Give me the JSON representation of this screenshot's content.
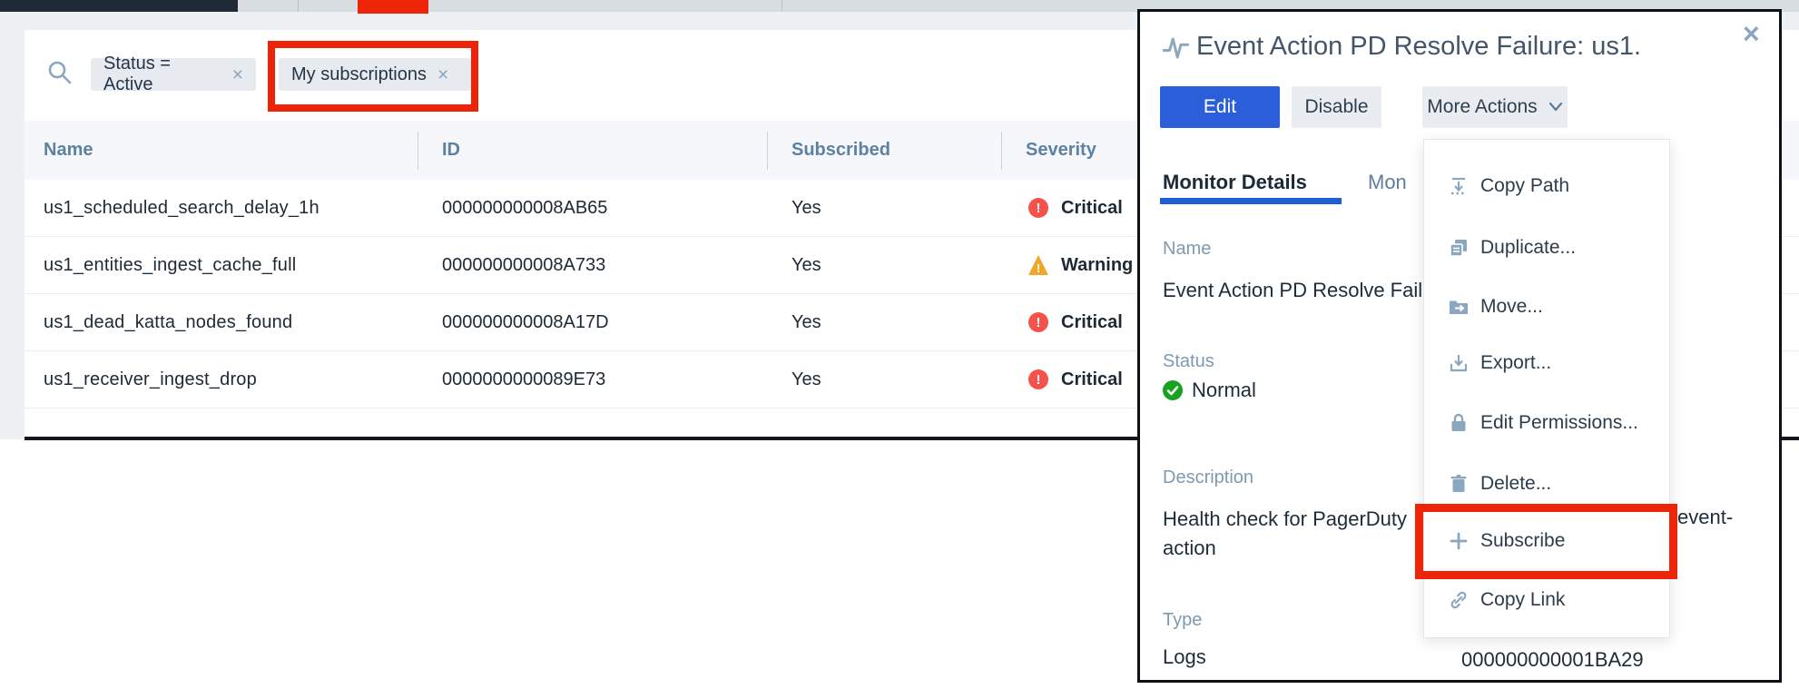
{
  "colors": {
    "annotation_red": "#ee2408",
    "primary_blue": "#2b5fd9",
    "tab_underline_blue": "#1f5ed6",
    "critical_red": "#f4524b",
    "warning_amber": "#eda82a",
    "normal_green": "#17a21f",
    "steel_label": "#7e9ab2",
    "header_text": "#5d81a1"
  },
  "filter_bar": {
    "search_icon": "search-icon",
    "chips": [
      {
        "label": "Status = Active",
        "close": "×"
      },
      {
        "label": "My subscriptions",
        "close": "×"
      }
    ]
  },
  "table": {
    "columns": [
      "Name",
      "ID",
      "Subscribed",
      "Severity"
    ],
    "rows": [
      {
        "name": "us1_scheduled_search_delay_1h",
        "id": "000000000008AB65",
        "subscribed": "Yes",
        "severity": "Critical",
        "severity_level": "critical"
      },
      {
        "name": "us1_entities_ingest_cache_full",
        "id": "000000000008A733",
        "subscribed": "Yes",
        "severity": "Warning",
        "severity_level": "warning"
      },
      {
        "name": "us1_dead_katta_nodes_found",
        "id": "000000000008A17D",
        "subscribed": "Yes",
        "severity": "Critical",
        "severity_level": "critical"
      },
      {
        "name": "us1_receiver_ingest_drop",
        "id": "0000000000089E73",
        "subscribed": "Yes",
        "severity": "Critical",
        "severity_level": "critical"
      }
    ]
  },
  "detail_panel": {
    "title": "Event Action PD Resolve Failure: us1.",
    "title_icon": "pulse-icon",
    "close": "×",
    "buttons": {
      "edit": "Edit",
      "disable": "Disable",
      "more_actions": "More Actions"
    },
    "tabs": {
      "active": "Monitor Details",
      "partial": "Mon"
    },
    "fields": {
      "name_label": "Name",
      "name_value": "Event Action PD Resolve Fail",
      "status_label": "Status",
      "status_value": "Normal",
      "description_label": "Description",
      "description_line1_left": "Health check for PagerDuty",
      "description_line1_right": "event-",
      "description_line2": "action",
      "type_label": "Type",
      "type_value": "Logs",
      "id_value": "000000000001BA29"
    }
  },
  "more_actions_menu": {
    "items": [
      {
        "label": "Copy Path",
        "icon": "copy-path-icon"
      },
      {
        "label": "Duplicate...",
        "icon": "duplicate-icon"
      },
      {
        "label": "Move...",
        "icon": "move-folder-icon"
      },
      {
        "label": "Export...",
        "icon": "export-icon"
      },
      {
        "label": "Edit Permissions...",
        "icon": "lock-icon"
      },
      {
        "label": "Delete...",
        "icon": "trash-icon"
      },
      {
        "label": "Subscribe",
        "icon": "plus-icon"
      },
      {
        "label": "Copy Link",
        "icon": "link-icon"
      }
    ]
  }
}
